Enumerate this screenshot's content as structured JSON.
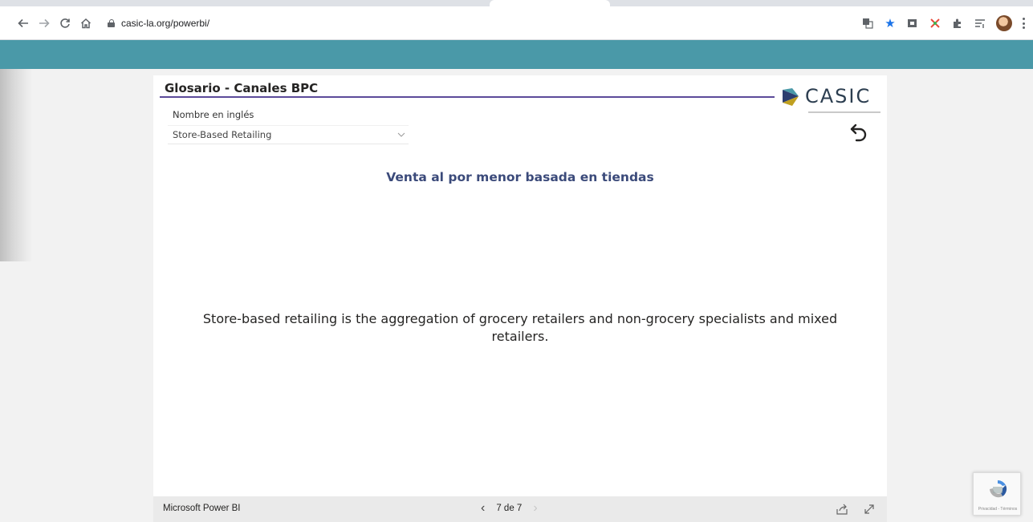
{
  "browser": {
    "url": "casic-la.org/powerbi/",
    "colors": {
      "teal_bar": "#4a99a8",
      "bookmark_star": "#1a73e8"
    }
  },
  "report": {
    "title": "Glosario - Canales BPC",
    "logo_text": "CASIC",
    "field_label": "Nombre en inglés",
    "selected_value": "Store-Based Retailing",
    "heading": "Venta al por menor basada en tiendas",
    "description": "Store-based retailing is the aggregation of grocery retailers and non-grocery specialists and mixed retailers.",
    "colors": {
      "title_underline": "#5c4a9a",
      "heading": "#3b4a7a"
    }
  },
  "footer": {
    "brand": "Microsoft Power BI",
    "page_indicator": "7 de 7"
  },
  "recaptcha": {
    "label": "Privacidad - Términos"
  }
}
